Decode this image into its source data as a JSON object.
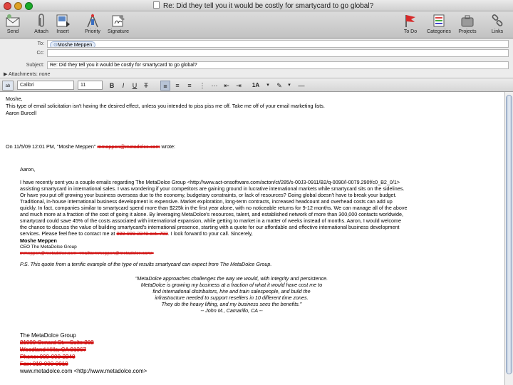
{
  "window": {
    "title": "Re: Did they tell you it would be costly for smartycard to go global?"
  },
  "toolbar": {
    "send": "Send",
    "attach": "Attach",
    "insert": "Insert",
    "priority": "Priority",
    "signature": "Signature",
    "todo": "To Do",
    "categories": "Categories",
    "projects": "Projects",
    "links": "Links"
  },
  "header": {
    "to_label": "To:",
    "to_value": "Moshe Meppen",
    "cc_label": "Cc:",
    "subject_label": "Subject:",
    "subject_value": "Re: Did they tell you it would be costly for smartycard to go global?",
    "attachments_label": "Attachments:",
    "attachments_value": "none"
  },
  "format": {
    "font": "Calibri",
    "size": "11"
  },
  "reply": {
    "greeting": "Moshe,",
    "line1": "This type of email solicitation isn't having the desired effect, unless you intended to piss piss me off.  Take me off of your email marketing lists.",
    "signoff": "Aaron Burcell"
  },
  "quote": {
    "attribution": "On 11/5/09 12:01 PM, \"Moshe Meppen\"",
    "attribution_email": "mmeppen@metadolce.com",
    "wrote": "wrote:",
    "salutation": "Aaron,",
    "paragraph": [
      "I have recently sent you a couple emails regarding The MetaDolce Group <http://www.act-onsoftware.com/acton/ct/285/s-00J3-0911/B2/q-0090/l-0079.290f/c0_B2_0/1>",
      "assisting smartycard in international sales.  I was wondering if your competitors are gaining ground in lucrative international markets while smartycard sits on the sidelines.",
      "Or have you put off growing your business overseas due to the economy, budgetary constraints, or lack of resources? Going global doesn't have to break your budget.",
      "Traditional, in-house international business development is expensive.  Market exploration, long-term contracts, increased headcount and overhead costs can add up",
      "quickly.  In fact, companies similar to smartycard spend more than $225k in the first year alone, with no noticeable returns for 9-12 months.  We can manage all of the above",
      "and much more at a fraction of the cost of going it alone.  By leveraging MetaDolce's resources, talent, and established network of more than 300,000 contacts worldwide,",
      "smartycard could save 45% of the costs associated with international expansion, while getting to market in a matter of weeks instead of months. Aaron, I would welcome",
      "the chance to discuss the value of building smartycard's international presence, starting with a quote for our affordable and effective international business development",
      "services.  Please feel free to contact me at"
    ],
    "phone_struck": "000-000-2340 ext. 703",
    "closing": ".  I look forward to your call. Sincerely,",
    "sender_name": "Moshe Meppen",
    "sender_title": "CEO  The MetaDolce Group",
    "sender_email_struck": "mmeppen@metadolce.com <mailto:mmeppen@metadolce.com>",
    "ps": "P.S.  This quote from a terrific example of the type of results smartycard can expect from The MetaDolce Group.",
    "testimonial": [
      "\"MetaDolce approaches challenges the way we would, with integrity and persistence.",
      "MetaDolce is growing my business at a fraction of what it would have cost me to",
      "find international distributors, hire and train salespeople, and build the",
      "infrastructure needed to support resellers in 10 different time zones.",
      "They do the heavy lifting, and my business sees the benefits.\"",
      "-- John M., Camarillo, CA --"
    ],
    "company": "The MetaDolce Group",
    "address_struck": [
      "21000 Oxnard St. - Suite 202",
      "Woodland Hills, CA 91367",
      "Phone: 000-000-2340",
      "Fax: 818-000-0010"
    ],
    "website": "www.metadolce.com <http://www.metadolce.com>"
  },
  "colors": {
    "redaction": "#d21010",
    "body_bg": "#ffffff",
    "chrome_bg": "#ececec"
  }
}
